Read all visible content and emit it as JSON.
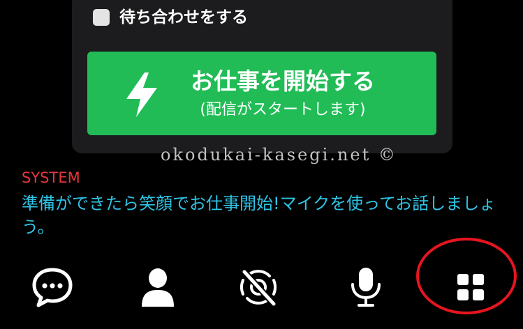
{
  "wait_option": {
    "label": "待ち合わせをする",
    "checked": false
  },
  "start_button": {
    "title": "お仕事を開始する",
    "subtitle": "(配信がスタートします)",
    "icon": "lightning-bolt-icon",
    "color": "#21bc56"
  },
  "watermark": {
    "text": "okodukai-kasegi.net ©"
  },
  "system": {
    "label": "SYSTEM",
    "message": "準備ができたら笑顔でお仕事開始!マイクを使ってお話しましょう。",
    "label_color": "#e8373c",
    "message_color": "#2fc4e6"
  },
  "toolbar": {
    "items": [
      {
        "icon": "chat-bubble-icon"
      },
      {
        "icon": "person-icon"
      },
      {
        "icon": "camera-off-icon"
      },
      {
        "icon": "microphone-icon"
      },
      {
        "icon": "grid-menu-icon"
      }
    ],
    "highlight_color": "#e8141e"
  }
}
